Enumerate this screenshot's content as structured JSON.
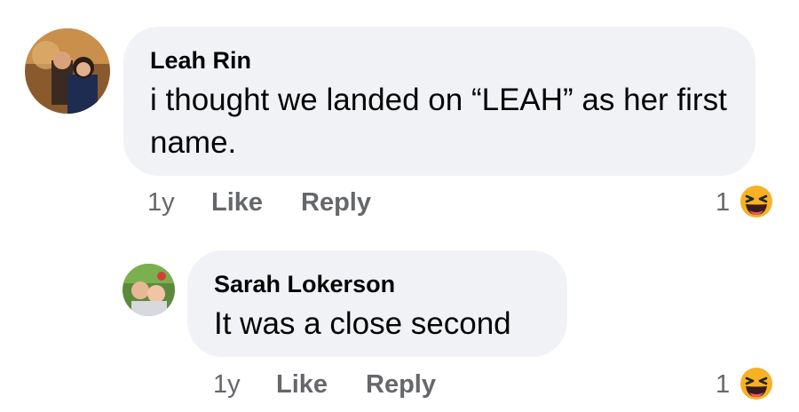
{
  "comments": [
    {
      "author": "Leah Rin",
      "text": "i thought we landed on “LEAH” as her first name.",
      "time": "1y",
      "like_label": "Like",
      "reply_label": "Reply",
      "reaction_count": "1",
      "reaction_icon": "laughing-emoji-icon"
    },
    {
      "author": "Sarah Lokerson",
      "text": "It was a close second",
      "time": "1y",
      "like_label": "Like",
      "reply_label": "Reply",
      "reaction_count": "1",
      "reaction_icon": "laughing-emoji-icon"
    }
  ],
  "colors": {
    "bubble": "#f0f2f5",
    "meta": "#65676b",
    "reaction": "#f7b125"
  }
}
